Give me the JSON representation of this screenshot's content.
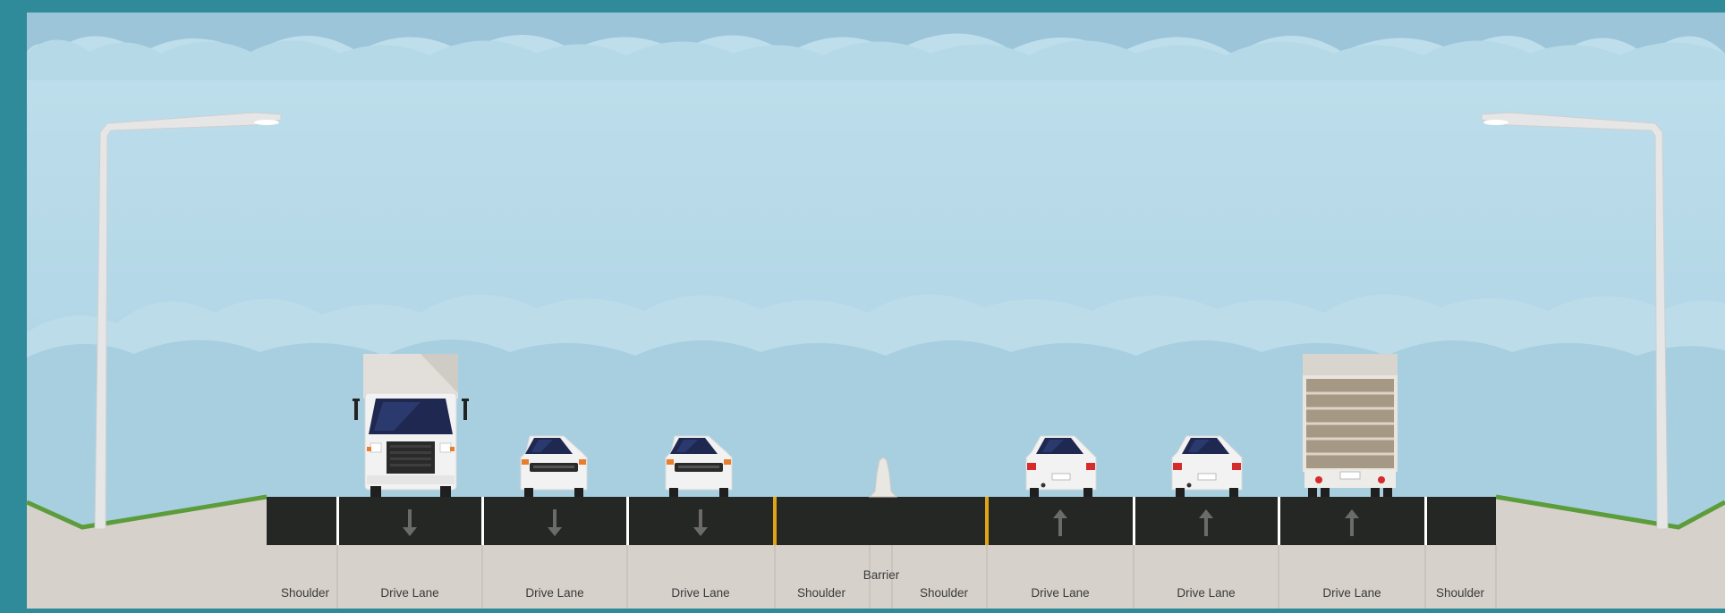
{
  "labels": {
    "left_shoulder": "Shoulder",
    "lane_1": "Drive Lane",
    "lane_2": "Drive Lane",
    "lane_3": "Drive Lane",
    "median_shoulder_left": "Shoulder",
    "barrier": "Barrier",
    "median_shoulder_right": "Shoulder",
    "lane_4": "Drive Lane",
    "lane_5": "Drive Lane",
    "lane_6": "Drive Lane",
    "right_shoulder": "Shoulder"
  },
  "lane_directions": [
    "down",
    "down",
    "down",
    "up",
    "up",
    "up"
  ],
  "colors": {
    "frame": "#2f8a9a",
    "sky": "#b3d6e6",
    "asphalt": "#252725",
    "ground": "#d6d1cb",
    "grass": "#5d9c3b",
    "median_line": "#e2a417",
    "lane_line": "#ffffff"
  }
}
